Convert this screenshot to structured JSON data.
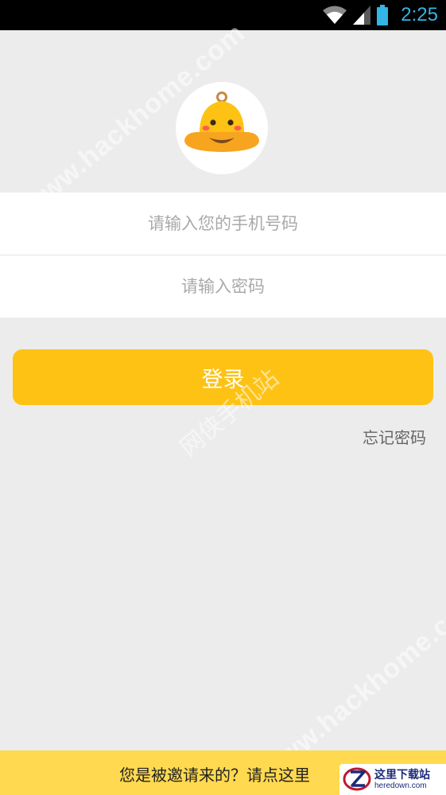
{
  "status_bar": {
    "time": "2:25",
    "icons": [
      "wifi-icon",
      "signal-icon",
      "battery-icon"
    ],
    "accent_color": "#33b5e5"
  },
  "avatar": {
    "icon": "bell-mascot-icon",
    "colors": {
      "bell": "#fec214",
      "brim": "#f7a51f",
      "cheeks": "#ff5a4f"
    }
  },
  "login_form": {
    "phone_placeholder": "请输入您的手机号码",
    "password_placeholder": "请输入密码",
    "login_label": "登录",
    "forgot_label": "忘记密码",
    "button_color": "#fec214"
  },
  "invite": {
    "label": "您是被邀请来的？请点这里",
    "background_color": "#ffd94f"
  },
  "watermarks": {
    "top": "www.hackhome.com",
    "center": "网侠手机站",
    "bottom": "www.hackhome.com",
    "corner_title": "这里下载站",
    "corner_sub": "heredown.com"
  }
}
